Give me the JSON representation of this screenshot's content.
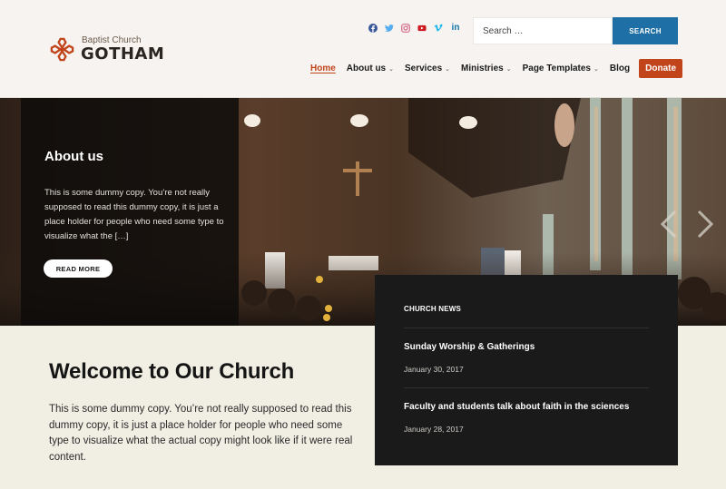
{
  "brand": {
    "subtitle": "Baptist Church",
    "name": "GOTHAM",
    "accent_color": "#c2441a"
  },
  "social": [
    {
      "name": "facebook-icon",
      "glyph": "f",
      "color": "#3b5998"
    },
    {
      "name": "twitter-icon",
      "glyph": "t",
      "color": "#55acee"
    },
    {
      "name": "instagram-icon",
      "glyph": "◎",
      "color": "#d46a8a"
    },
    {
      "name": "youtube-icon",
      "glyph": "▶",
      "color": "#cc181e"
    },
    {
      "name": "vimeo-icon",
      "glyph": "v",
      "color": "#1ab7ea"
    },
    {
      "name": "linkedin-icon",
      "glyph": "in",
      "color": "#0e76a8"
    }
  ],
  "search": {
    "placeholder": "Search …",
    "button_label": "SEARCH",
    "button_color": "#1d6fa5"
  },
  "nav": {
    "items": [
      {
        "label": "Home",
        "active": true,
        "dropdown": false
      },
      {
        "label": "About us",
        "active": false,
        "dropdown": true
      },
      {
        "label": "Services",
        "active": false,
        "dropdown": true
      },
      {
        "label": "Ministries",
        "active": false,
        "dropdown": true
      },
      {
        "label": "Page Templates",
        "active": false,
        "dropdown": true
      },
      {
        "label": "Blog",
        "active": false,
        "dropdown": false
      }
    ],
    "donate_label": "Donate",
    "chevron": "⌄"
  },
  "hero": {
    "about_title": "About us",
    "about_text": "This is some dummy copy. You’re not really supposed to read this dummy copy, it is just a place holder for people who need some type to visualize what the […]",
    "read_more_label": "READ MORE"
  },
  "news": {
    "title": "CHURCH NEWS",
    "items": [
      {
        "title": "Sunday Worship & Gatherings",
        "date": "January 30, 2017"
      },
      {
        "title": "Faculty and students talk about faith in the sciences",
        "date": "January 28, 2017"
      }
    ]
  },
  "welcome": {
    "title": "Welcome to Our Church",
    "text": "This is some dummy copy. You’re not really supposed to read this dummy copy, it is just a place holder for people who need some type to visualize what the actual copy might look like if it were real content."
  }
}
